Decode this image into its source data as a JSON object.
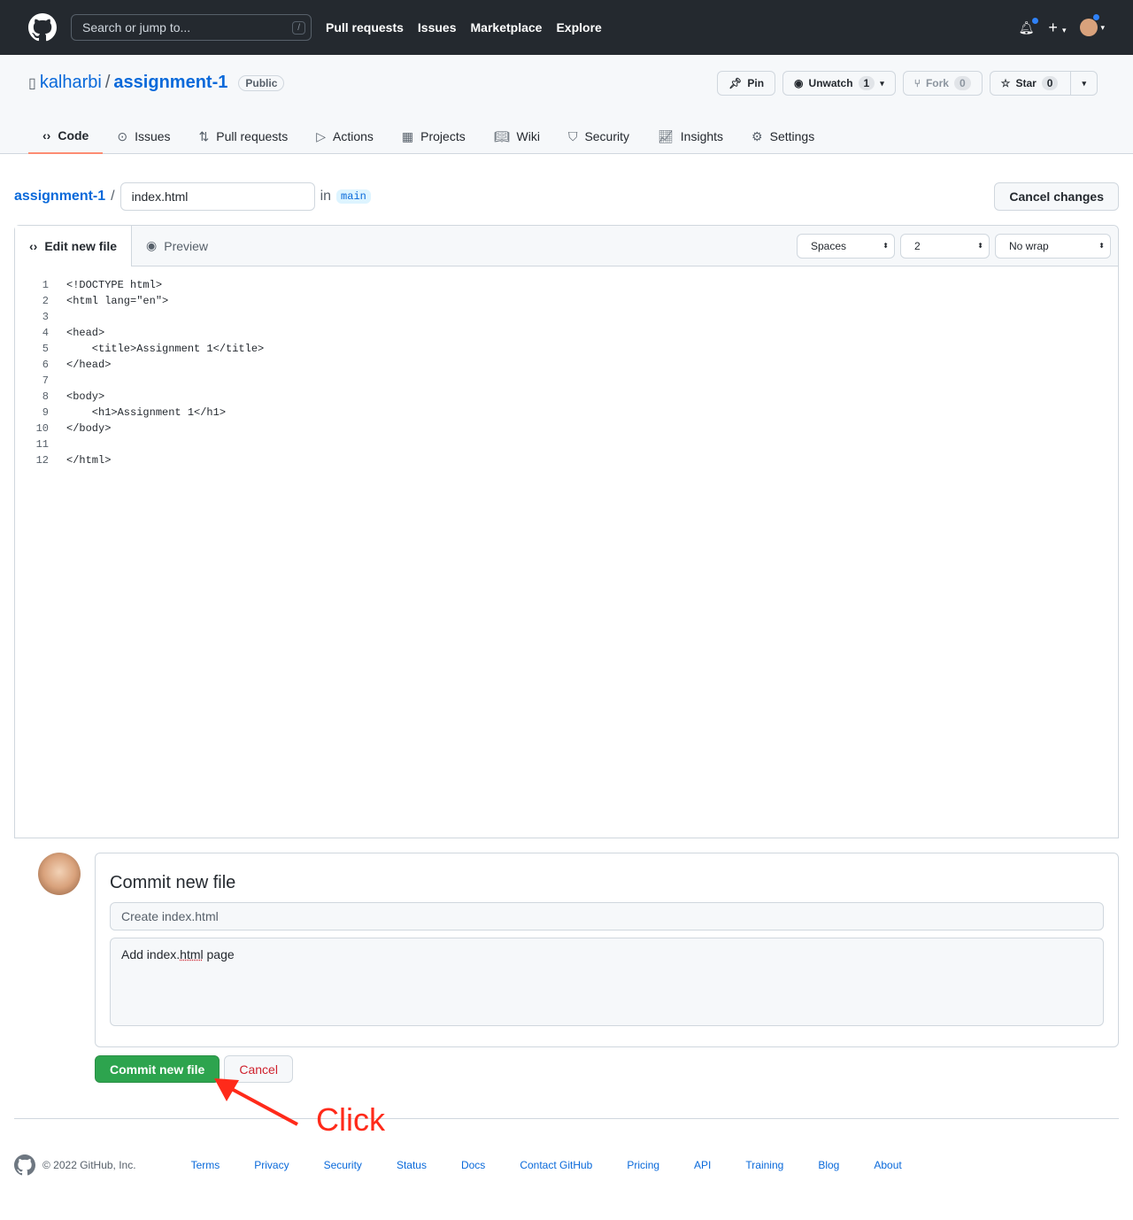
{
  "header": {
    "search_placeholder": "Search or jump to...",
    "search_shortcut": "/",
    "nav": [
      "Pull requests",
      "Issues",
      "Marketplace",
      "Explore"
    ]
  },
  "repo": {
    "owner": "kalharbi",
    "name": "assignment-1",
    "visibility": "Public",
    "actions": {
      "pin": "Pin",
      "unwatch": "Unwatch",
      "watch_count": "1",
      "fork": "Fork",
      "fork_count": "0",
      "star": "Star",
      "star_count": "0"
    },
    "tabs": [
      "Code",
      "Issues",
      "Pull requests",
      "Actions",
      "Projects",
      "Wiki",
      "Security",
      "Insights",
      "Settings"
    ]
  },
  "editor": {
    "repo_link": "assignment-1",
    "filename": "index.html",
    "in_label": "in",
    "branch": "main",
    "cancel_changes": "Cancel changes",
    "tab_edit": "Edit new file",
    "tab_preview": "Preview",
    "indent_mode": "Spaces",
    "indent_size": "2",
    "wrap_mode": "No wrap",
    "lines": [
      "<!DOCTYPE html>",
      "<html lang=\"en\">",
      "",
      "<head>",
      "    <title>Assignment 1</title>",
      "</head>",
      "",
      "<body>",
      "    <h1>Assignment 1</h1>",
      "</body>",
      "",
      "</html>"
    ]
  },
  "commit": {
    "title": "Commit new file",
    "summary_placeholder": "Create index.html",
    "description_pre": "Add index.",
    "description_spell": "html",
    "description_post": " page",
    "commit_button": "Commit new file",
    "cancel_button": "Cancel"
  },
  "annotation": {
    "text": "Click",
    "color": "#ff2a1a"
  },
  "footer": {
    "copyright": "© 2022 GitHub, Inc.",
    "links": [
      "Terms",
      "Privacy",
      "Security",
      "Status",
      "Docs",
      "Contact GitHub",
      "Pricing",
      "API",
      "Training",
      "Blog",
      "About"
    ]
  }
}
